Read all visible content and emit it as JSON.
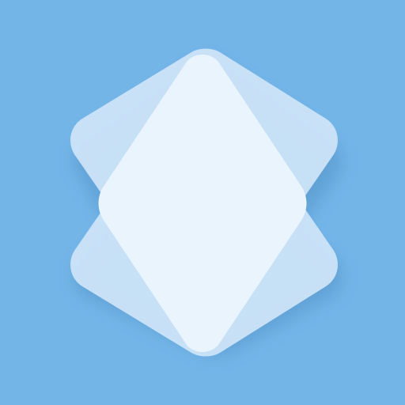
{
  "app_icon": {
    "icon_name": "layered-diamond-logo-icon",
    "colors": {
      "background": "#74b5e8",
      "card_back": "#cfe5f8",
      "card_front": "#eaf4fd",
      "shadow": "#3f7fb3"
    }
  }
}
